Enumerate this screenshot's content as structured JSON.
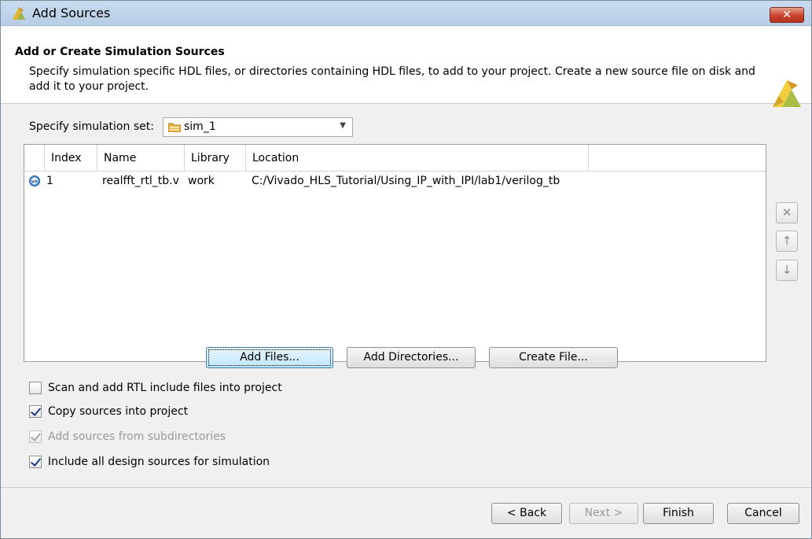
{
  "window": {
    "title": "Add Sources",
    "close_label": "x"
  },
  "header": {
    "title": "Add or Create Simulation Sources",
    "description": "Specify simulation specific HDL files, or directories containing HDL files, to add to your project. Create a new source file on disk and add it to your project."
  },
  "simulation_set": {
    "label": "Specify simulation set:",
    "value": "sim_1"
  },
  "table": {
    "columns": [
      "Index",
      "Name",
      "Library",
      "Location"
    ],
    "rows": [
      {
        "index": "1",
        "name": "realfft_rtl_tb.v",
        "library": "work",
        "location": "C:/Vivado_HLS_Tutorial/Using_IP_with_IPI/lab1/verilog_tb"
      }
    ]
  },
  "side_buttons": {
    "remove": "✕",
    "move_up": "↑",
    "move_down": "↓"
  },
  "actions": {
    "add_files": "Add Files...",
    "add_directories": "Add Directories...",
    "create_file": "Create File..."
  },
  "options": [
    {
      "label": "Scan and add RTL include files into project",
      "checked": false,
      "disabled": false
    },
    {
      "label": "Copy sources into project",
      "checked": true,
      "disabled": false
    },
    {
      "label": "Add sources from subdirectories",
      "checked": true,
      "disabled": true
    },
    {
      "label": "Include all design sources for simulation",
      "checked": true,
      "disabled": false
    }
  ],
  "footer": {
    "back": "< Back",
    "next": "Next >",
    "finish": "Finish",
    "cancel": "Cancel"
  },
  "colors": {
    "titlebar": "#b9cfe7",
    "close": "#c8412b",
    "focus_button": "#bee6fd",
    "logo": "#e0c23c"
  }
}
